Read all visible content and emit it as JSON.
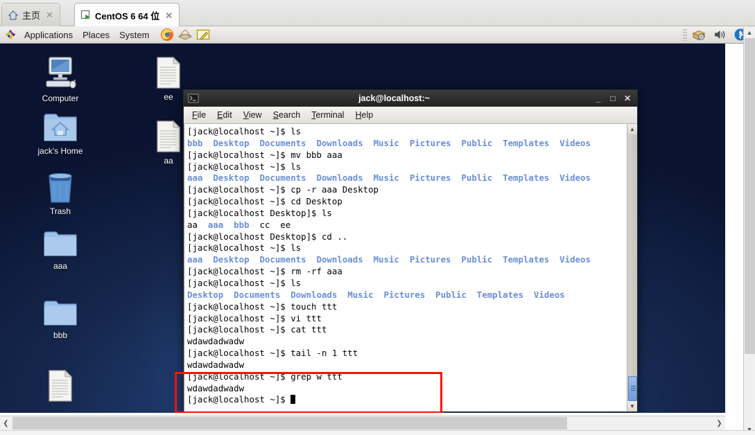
{
  "browser": {
    "tabs": [
      {
        "label": "主页",
        "icon": "home-icon",
        "close": "✕",
        "active": false
      },
      {
        "label": "CentOS 6 64 位",
        "icon": "vm-window-icon",
        "close": "✕",
        "active": true
      }
    ]
  },
  "panel": {
    "menus": [
      "Applications",
      "Places",
      "System"
    ],
    "launchers": [
      "firefox-icon",
      "evolution-mail-icon",
      "text-editor-icon"
    ],
    "tray": [
      "package-update-icon",
      "volume-icon",
      "bluetooth-icon"
    ]
  },
  "desktop": {
    "icons": [
      {
        "label": "Computer",
        "type": "computer-icon"
      },
      {
        "label": "jack's Home",
        "type": "home-folder-icon"
      },
      {
        "label": "Trash",
        "type": "trash-icon"
      },
      {
        "label": "aaa",
        "type": "folder-icon"
      },
      {
        "label": "bbb",
        "type": "folder-icon"
      },
      {
        "label": "",
        "type": "document-icon"
      },
      {
        "label": "ee",
        "type": "document-icon"
      },
      {
        "label": "aa",
        "type": "document-icon"
      }
    ]
  },
  "terminal": {
    "title": "jack@localhost:~",
    "window_icon": "terminal-icon",
    "buttons": {
      "minimize": "_",
      "maximize": "□",
      "close": "✕"
    },
    "menu": [
      "File",
      "Edit",
      "View",
      "Search",
      "Terminal",
      "Help"
    ],
    "prompt_home": "[jack@localhost ~]$ ",
    "prompt_desktop": "[jack@localhost Desktop]$ ",
    "dir_color": "#6a8fd8",
    "lines": [
      {
        "prompt": "home",
        "cmd": "ls"
      },
      {
        "out": [
          {
            "t": "bbb",
            "d": true
          },
          {
            "t": "Desktop",
            "d": true
          },
          {
            "t": "Documents",
            "d": true
          },
          {
            "t": "Downloads",
            "d": true
          },
          {
            "t": "Music",
            "d": true
          },
          {
            "t": "Pictures",
            "d": true
          },
          {
            "t": "Public",
            "d": true
          },
          {
            "t": "Templates",
            "d": true
          },
          {
            "t": "Videos",
            "d": true
          }
        ]
      },
      {
        "prompt": "home",
        "cmd": "mv bbb aaa"
      },
      {
        "prompt": "home",
        "cmd": "ls"
      },
      {
        "out": [
          {
            "t": "aaa",
            "d": true
          },
          {
            "t": "Desktop",
            "d": true
          },
          {
            "t": "Documents",
            "d": true
          },
          {
            "t": "Downloads",
            "d": true
          },
          {
            "t": "Music",
            "d": true
          },
          {
            "t": "Pictures",
            "d": true
          },
          {
            "t": "Public",
            "d": true
          },
          {
            "t": "Templates",
            "d": true
          },
          {
            "t": "Videos",
            "d": true
          }
        ]
      },
      {
        "prompt": "home",
        "cmd": "cp -r aaa Desktop"
      },
      {
        "prompt": "home",
        "cmd": "cd Desktop"
      },
      {
        "prompt": "desktop",
        "cmd": "ls"
      },
      {
        "out": [
          {
            "t": "aa",
            "d": false
          },
          {
            "t": "aaa",
            "d": true
          },
          {
            "t": "bbb",
            "d": true
          },
          {
            "t": "cc",
            "d": false
          },
          {
            "t": "ee",
            "d": false
          }
        ]
      },
      {
        "prompt": "desktop",
        "cmd": "cd .."
      },
      {
        "prompt": "home",
        "cmd": "ls"
      },
      {
        "out": [
          {
            "t": "aaa",
            "d": true
          },
          {
            "t": "Desktop",
            "d": true
          },
          {
            "t": "Documents",
            "d": true
          },
          {
            "t": "Downloads",
            "d": true
          },
          {
            "t": "Music",
            "d": true
          },
          {
            "t": "Pictures",
            "d": true
          },
          {
            "t": "Public",
            "d": true
          },
          {
            "t": "Templates",
            "d": true
          },
          {
            "t": "Videos",
            "d": true
          }
        ]
      },
      {
        "prompt": "home",
        "cmd": "rm -rf aaa"
      },
      {
        "prompt": "home",
        "cmd": "ls"
      },
      {
        "out": [
          {
            "t": "Desktop",
            "d": true
          },
          {
            "t": "Documents",
            "d": true
          },
          {
            "t": "Downloads",
            "d": true
          },
          {
            "t": "Music",
            "d": true
          },
          {
            "t": "Pictures",
            "d": true
          },
          {
            "t": "Public",
            "d": true
          },
          {
            "t": "Templates",
            "d": true
          },
          {
            "t": "Videos",
            "d": true
          }
        ]
      },
      {
        "prompt": "home",
        "cmd": "touch ttt"
      },
      {
        "prompt": "home",
        "cmd": "vi ttt"
      },
      {
        "prompt": "home",
        "cmd": "cat ttt"
      },
      {
        "out": [
          {
            "t": "wdawdadwadw",
            "d": false
          }
        ]
      },
      {
        "prompt": "home",
        "cmd": "tail -n 1 ttt"
      },
      {
        "out": [
          {
            "t": "wdawdadwadw",
            "d": false
          }
        ]
      },
      {
        "prompt": "home",
        "cmd": "grep w ttt"
      },
      {
        "out": [
          {
            "t": "wdawdadwadw",
            "d": false
          }
        ]
      },
      {
        "prompt": "home",
        "cmd": "",
        "caret": true
      }
    ]
  },
  "annotation": {
    "highlight_color": "#ff1100"
  },
  "scrollbars": {
    "terminal_arrow_up": "▲",
    "terminal_arrow_down": "▼",
    "page_arrow_up": "▲",
    "page_arrow_down": "▼",
    "page_arrow_left": "❮",
    "page_arrow_right": "❯"
  }
}
